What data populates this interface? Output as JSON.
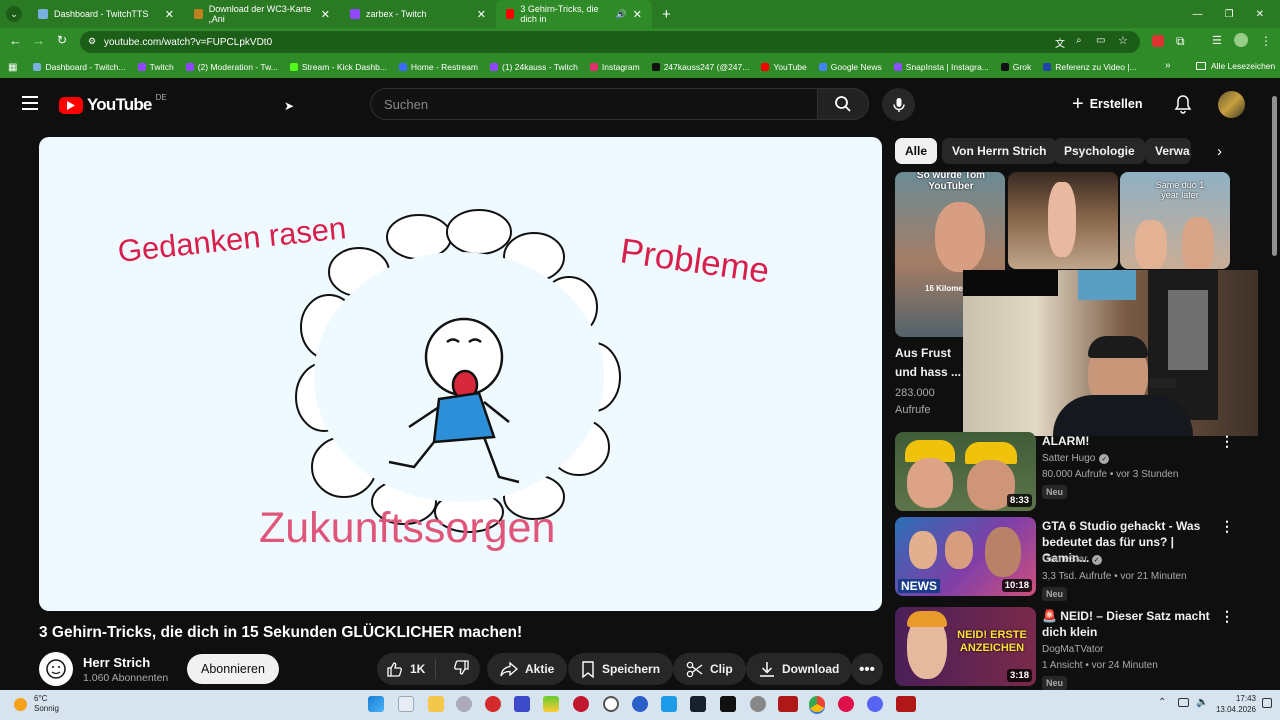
{
  "browser": {
    "tabs": [
      {
        "label": "Dashboard - TwitchTTS",
        "favicon_color": "#7ab0e0"
      },
      {
        "label": "Download der WC3-Karte „Ani",
        "favicon_color": "#c08020"
      },
      {
        "label": "zarbex - Twitch",
        "favicon_color": "#9146ff"
      },
      {
        "label": "3 Gehirn-Tricks, die dich in",
        "favicon_color": "#ff0000"
      }
    ],
    "url": "youtube.com/watch?v=FUPCLpkVDt0",
    "bookmarks": [
      {
        "label": "Dashboard - Twitch...",
        "color": "#7ab0e0"
      },
      {
        "label": "Twitch",
        "color": "#9146ff"
      },
      {
        "label": "(2) Moderation - Tw...",
        "color": "#9146ff"
      },
      {
        "label": "Stream - Kick Dashb...",
        "color": "#53fc18"
      },
      {
        "label": "Home - Restream",
        "color": "#3b6cff"
      },
      {
        "label": "(1) 24kauss - Twitch",
        "color": "#9146ff"
      },
      {
        "label": "Instagram",
        "color": "#e1306c"
      },
      {
        "label": "247kauss247 (@247...",
        "color": "#111111"
      },
      {
        "label": "YouTube",
        "color": "#ff0000"
      },
      {
        "label": "Google News",
        "color": "#4285f4"
      },
      {
        "label": "SnapInsta | Instagra...",
        "color": "#8a4fff"
      },
      {
        "label": "Grok",
        "color": "#111111"
      },
      {
        "label": "Referenz zu Video |...",
        "color": "#2244aa"
      }
    ],
    "all_bookmarks_label": "Alle Lesezeichen"
  },
  "youtube": {
    "logo_text": "YouTube",
    "country": "DE",
    "search_placeholder": "Suchen",
    "create_label": "Erstellen",
    "video": {
      "title": "3 Gehirn-Tricks, die dich in 15 Sekunden GLÜCKLICHER machen!",
      "frame_texts": {
        "left": "Gedanken rasen",
        "right": "Probleme",
        "bottom": "Zukunftssorgen"
      },
      "channel": "Herr Strich",
      "subscribers": "1.060 Abonnenten",
      "subscribe_label": "Abonnieren",
      "likes": "1K",
      "share_label": "Aktie",
      "save_label": "Speichern",
      "clip_label": "Clip",
      "download_label": "Download"
    },
    "chips": [
      "Alle",
      "Von Herrn Strich",
      "Psychologie",
      "Verwa"
    ],
    "shorts": [
      {
        "overlay": "So wurde Tom YouTuber"
      },
      {
        "overlay": ""
      },
      {
        "overlay": "Same duo 1 year later"
      }
    ],
    "featured": {
      "title_line1": "Aus Frust",
      "title_line2": "und hass ...",
      "views": "283.000",
      "views_label": "Aufrufe",
      "thumb_text": "16 Kilome"
    },
    "recommendations": [
      {
        "title": "ALARM!",
        "channel": "Satter Hugo",
        "meta": "80.000 Aufrufe • vor 3 Stunden",
        "badge": "Neu",
        "duration": "8:33",
        "thumb_overlay": ""
      },
      {
        "title": "GTA 6 Studio gehackt - Was bedeutet das für uns? | Gamin...",
        "channel": "GameStar",
        "meta": "3,3 Tsd. Aufrufe • vor 21 Minuten",
        "badge": "Neu",
        "duration": "10:18",
        "thumb_overlay": "NEWS"
      },
      {
        "title": "🚨 NEID! – Dieser Satz macht dich klein",
        "channel": "DogMaTVator",
        "meta": "1 Ansicht • vor 24 Minuten",
        "badge": "Neu",
        "duration": "3:18",
        "thumb_overlay": "NEID! ERSTE ANZEICHEN"
      }
    ]
  },
  "taskbar": {
    "weather_temp": "6°C",
    "weather_desc": "Sonnig",
    "time": "17:43",
    "date": "13.04.2026"
  }
}
